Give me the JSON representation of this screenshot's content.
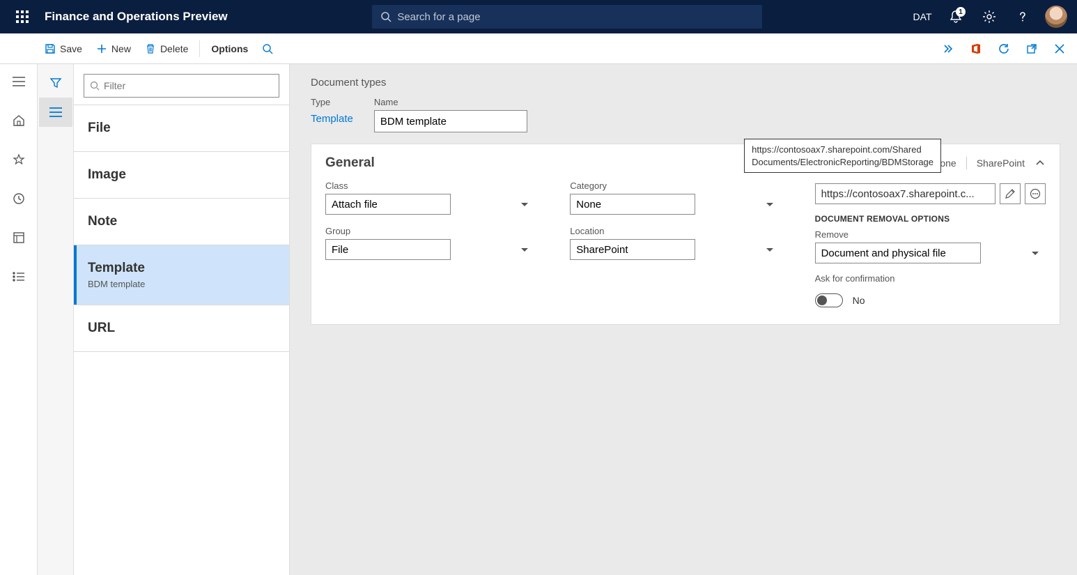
{
  "header": {
    "title": "Finance and Operations Preview",
    "search_placeholder": "Search for a page",
    "company": "DAT",
    "notification_count": "1"
  },
  "cmdbar": {
    "save": "Save",
    "new": "New",
    "delete": "Delete",
    "options": "Options"
  },
  "filter": {
    "placeholder": "Filter"
  },
  "list": {
    "items": [
      {
        "title": "File",
        "sub": ""
      },
      {
        "title": "Image",
        "sub": ""
      },
      {
        "title": "Note",
        "sub": ""
      },
      {
        "title": "Template",
        "sub": "BDM template"
      },
      {
        "title": "URL",
        "sub": ""
      }
    ]
  },
  "detail": {
    "page_title": "Document types",
    "type_label": "Type",
    "type_value": "Template",
    "name_label": "Name",
    "name_value": "BDM template",
    "card_title": "General",
    "none": "None",
    "sharepoint": "SharePoint",
    "class_label": "Class",
    "class_value": "Attach file",
    "category_label": "Category",
    "category_value": "None",
    "group_label": "Group",
    "group_value": "File",
    "location_label": "Location",
    "location_value": "SharePoint",
    "sp_address_display": "https://contosoax7.sharepoint.c...",
    "sp_address_full": "https://contosoax7.sharepoint.com/Shared Documents/ElectronicReporting/BDMStorage",
    "removal_header": "DOCUMENT REMOVAL OPTIONS",
    "remove_label": "Remove",
    "remove_value": "Document and physical file",
    "confirm_label": "Ask for confirmation",
    "confirm_value": "No"
  }
}
